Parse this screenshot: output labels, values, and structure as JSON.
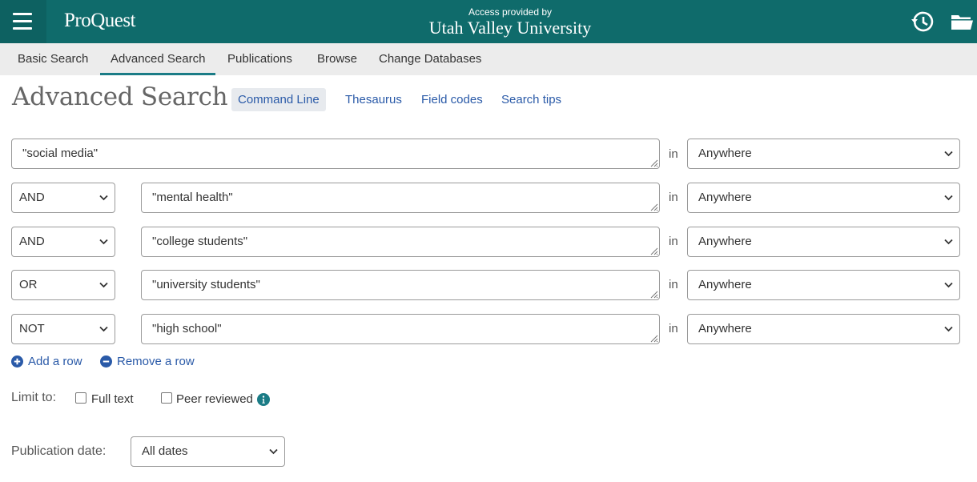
{
  "header": {
    "brand": "ProQuest",
    "access_line": "Access provided by",
    "institution": "Utah Valley University",
    "colors": {
      "header_bg": "#0f6b6b",
      "menu_bg": "#0d6161"
    },
    "icons": {
      "menu": "hamburger-menu-icon",
      "history": "history-icon",
      "folder": "folder-icon"
    }
  },
  "nav": {
    "items": [
      {
        "label": "Basic Search"
      },
      {
        "label": "Advanced Search",
        "active": true
      },
      {
        "label": "Publications"
      },
      {
        "label": "Browse"
      },
      {
        "label": "Change Databases"
      }
    ]
  },
  "title": {
    "text": "Advanced Search",
    "command_line": "Command Line",
    "links": [
      "Thesaurus",
      "Field codes",
      "Search tips"
    ]
  },
  "rows": [
    {
      "operator": null,
      "term": "\"social media\"",
      "in_label": "in",
      "field": "Anywhere"
    },
    {
      "operator": "AND",
      "term": "\"mental health\"",
      "in_label": "in",
      "field": "Anywhere"
    },
    {
      "operator": "AND",
      "term": "\"college students\"",
      "in_label": "in",
      "field": "Anywhere"
    },
    {
      "operator": "OR",
      "term": "\"university students\"",
      "in_label": "in",
      "field": "Anywhere"
    },
    {
      "operator": "NOT",
      "term": "\"high school\"",
      "in_label": "in",
      "field": "Anywhere"
    }
  ],
  "row_actions": {
    "add": "Add a row",
    "remove": "Remove a row"
  },
  "limits": {
    "label": "Limit to:",
    "full_text": {
      "label": "Full text",
      "checked": false
    },
    "peer_reviewed": {
      "label": "Peer reviewed",
      "checked": false
    }
  },
  "publication_date": {
    "label": "Publication date:",
    "value": "All dates"
  },
  "accent_color": "#2a5aa8"
}
